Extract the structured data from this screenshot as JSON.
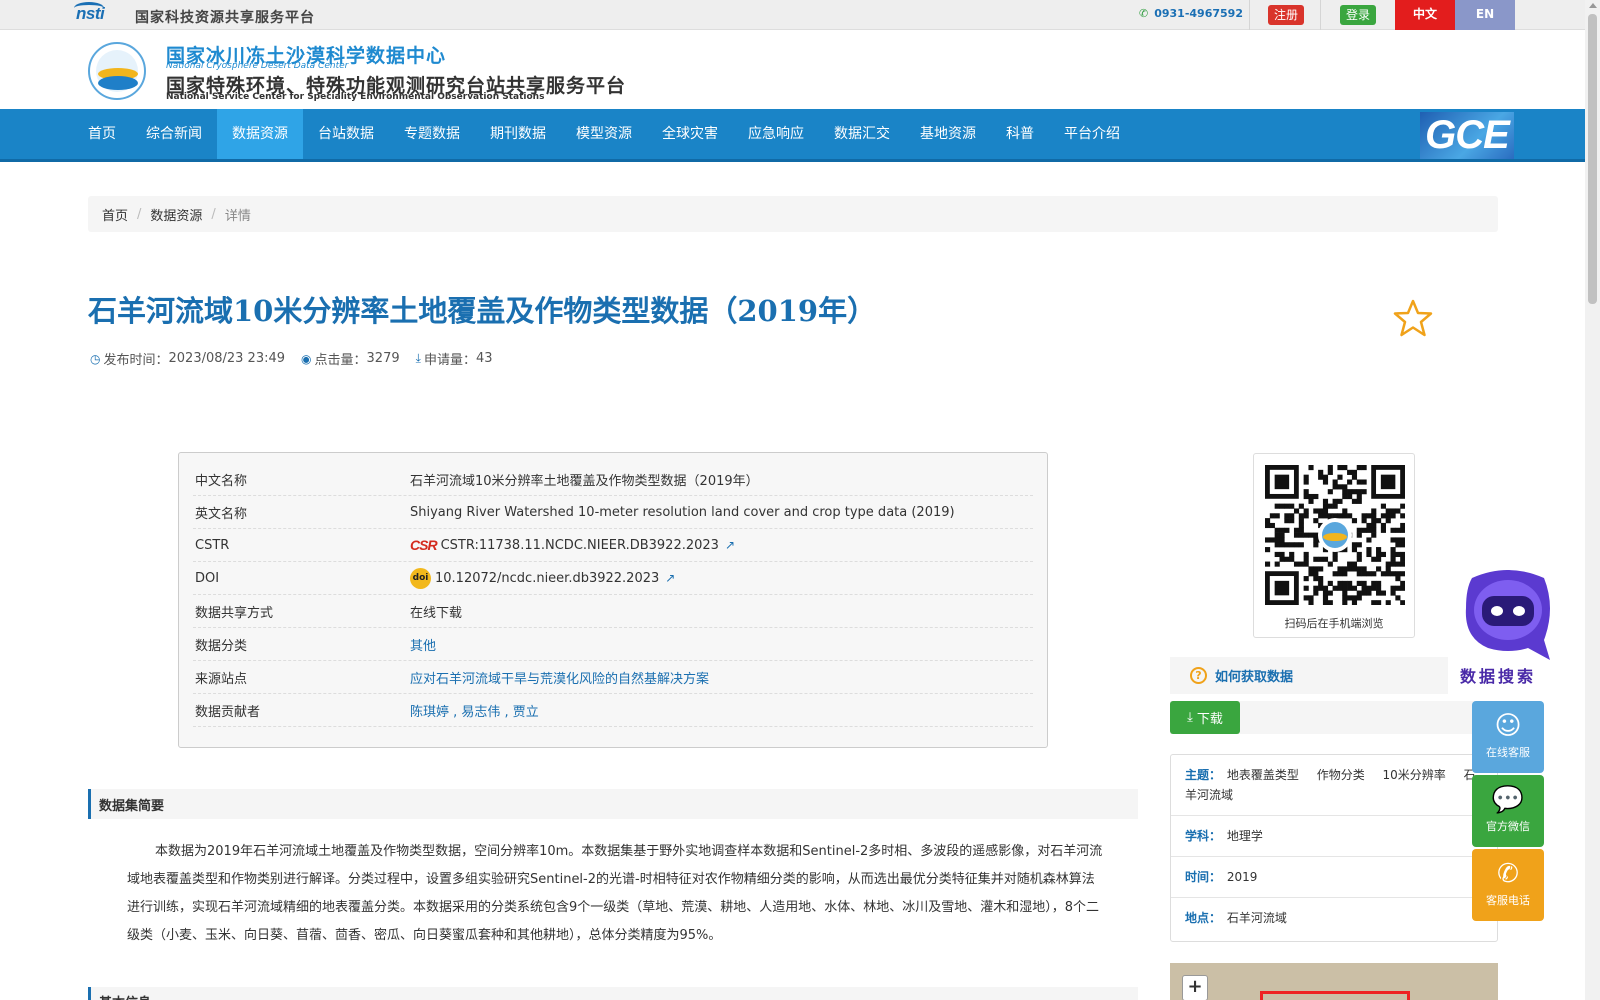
{
  "topbar": {
    "logo_text": "nsti",
    "platform_name": "国家科技资源共享服务平台",
    "phone": "0931-4967592",
    "register_label": "注册",
    "login_label": "登录",
    "lang_zh": "中文",
    "lang_en": "EN"
  },
  "header": {
    "center_cn": "国家冰川冻土沙漠科学数据中心",
    "center_en": "National Cryosphere Desert Data Center",
    "service_cn": "国家特殊环境、特殊功能观测研究台站共享服务平台",
    "service_en": "National Service Center for Speciality Environmental Observation Stations"
  },
  "nav": {
    "items": [
      {
        "label": "首页"
      },
      {
        "label": "综合新闻"
      },
      {
        "label": "数据资源"
      },
      {
        "label": "台站数据"
      },
      {
        "label": "专题数据"
      },
      {
        "label": "期刊数据"
      },
      {
        "label": "模型资源"
      },
      {
        "label": "全球灾害"
      },
      {
        "label": "应急响应"
      },
      {
        "label": "数据汇交"
      },
      {
        "label": "基地资源"
      },
      {
        "label": "科普"
      },
      {
        "label": "平台介绍"
      }
    ],
    "active_index": 2,
    "badge": "GCE"
  },
  "breadcrumb": {
    "home": "首页",
    "section": "数据资源",
    "current": "详情"
  },
  "dataset": {
    "title": "石羊河流域10米分辨率土地覆盖及作物类型数据（2019年）",
    "publish_label": "发布时间：",
    "publish_time": "2023/08/23 23:49",
    "clicks_label": "点击量：",
    "clicks": "3279",
    "requests_label": "申请量：",
    "requests": "43"
  },
  "info": {
    "cn_name_label": "中文名称",
    "cn_name": "石羊河流域10米分辨率土地覆盖及作物类型数据（2019年）",
    "en_name_label": "英文名称",
    "en_name": "Shiyang River Watershed 10-meter resolution land cover and crop type data (2019)",
    "cstr_label": "CSTR",
    "cstr_badge": "CSR",
    "cstr": "CSTR:11738.11.NCDC.NIEER.DB3922.2023",
    "doi_label": "DOI",
    "doi_badge": "doi",
    "doi": "10.12072/ncdc.nieer.db3922.2023",
    "share_label": "数据共享方式",
    "share": "在线下载",
    "category_label": "数据分类",
    "category": "其他",
    "source_label": "来源站点",
    "source": "应对石羊河流域干旱与荒漠化风险的自然基解决方案",
    "contributors_label": "数据贡献者",
    "contributors": "陈琪婷 , 易志伟 , 贾立"
  },
  "qr": {
    "caption": "扫码后在手机端浏览"
  },
  "robot": {
    "label": "数据搜索"
  },
  "sidebar": {
    "howto": "如何获取数据",
    "download": "下载",
    "theme_label": "主题：",
    "themes": [
      "地表覆盖类型",
      "作物分类",
      "10米分辨率",
      "石羊河流域"
    ],
    "discipline_label": "学科：",
    "discipline": "地理学",
    "time_label": "时间：",
    "time": "2019",
    "place_label": "地点：",
    "place": "石羊河流域",
    "map_zoom": "+"
  },
  "float_buttons": {
    "qq": "在线客服",
    "wechat": "官方微信",
    "phone": "客服电话"
  },
  "sections": {
    "abstract_title": "数据集简要",
    "abstract": "本数据为2019年石羊河流域土地覆盖及作物类型数据，空间分辨率10m。本数据集基于野外实地调查样本数据和Sentinel-2多时相、多波段的遥感影像，对石羊河流域地表覆盖类型和作物类别进行解译。分类过程中，设置多组实验研究Sentinel-2的光谱-时相特征对农作物精细分类的影响，从而选出最优分类特征集并对随机森林算法进行训练，实现石羊河流域精细的地表覆盖分类。本数据采用的分类系统包含9个一级类（草地、荒漠、耕地、人造用地、水体、林地、冰川及雪地、灌木和湿地），8个二级类（小麦、玉米、向日葵、苜蓿、茴香、密瓜、向日葵蜜瓜套种和其他耕地），总体分类精度为95%。",
    "basic_title": "基本信息"
  }
}
